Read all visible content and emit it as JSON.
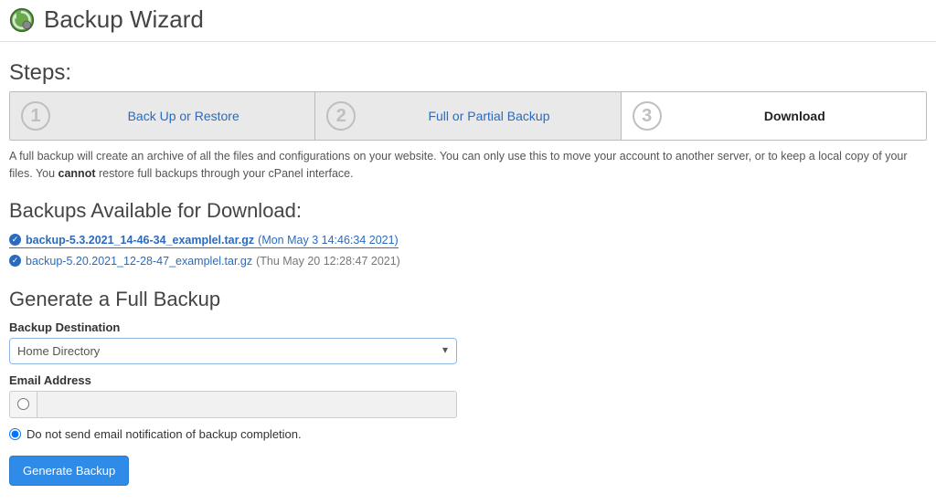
{
  "header": {
    "title": "Backup Wizard"
  },
  "steps_label": "Steps:",
  "steps": [
    {
      "num": "1",
      "label": "Back Up or Restore",
      "active": false
    },
    {
      "num": "2",
      "label": "Full or Partial Backup",
      "active": false
    },
    {
      "num": "3",
      "label": "Download",
      "active": true
    }
  ],
  "description": {
    "part1": "A full backup will create an archive of all the files and configurations on your website. You can only use this to move your account to another server, or to keep a local copy of your files. You ",
    "bold": "cannot",
    "part2": " restore full backups through your cPanel interface."
  },
  "backups_heading": "Backups Available for Download:",
  "backups": [
    {
      "file": "backup-5.3.2021_14-46-34_examplel.tar.gz",
      "date": "(Mon May 3 14:46:34 2021)",
      "highlight": true
    },
    {
      "file": "backup-5.20.2021_12-28-47_examplel.tar.gz",
      "date": "(Thu May 20 12:28:47 2021)",
      "highlight": false
    }
  ],
  "generate_heading": "Generate a Full Backup",
  "form": {
    "destination_label": "Backup Destination",
    "destination_value": "Home Directory",
    "email_label": "Email Address",
    "email_value": "",
    "notify_label": "Do not send email notification of backup completion.",
    "button": "Generate Backup"
  }
}
